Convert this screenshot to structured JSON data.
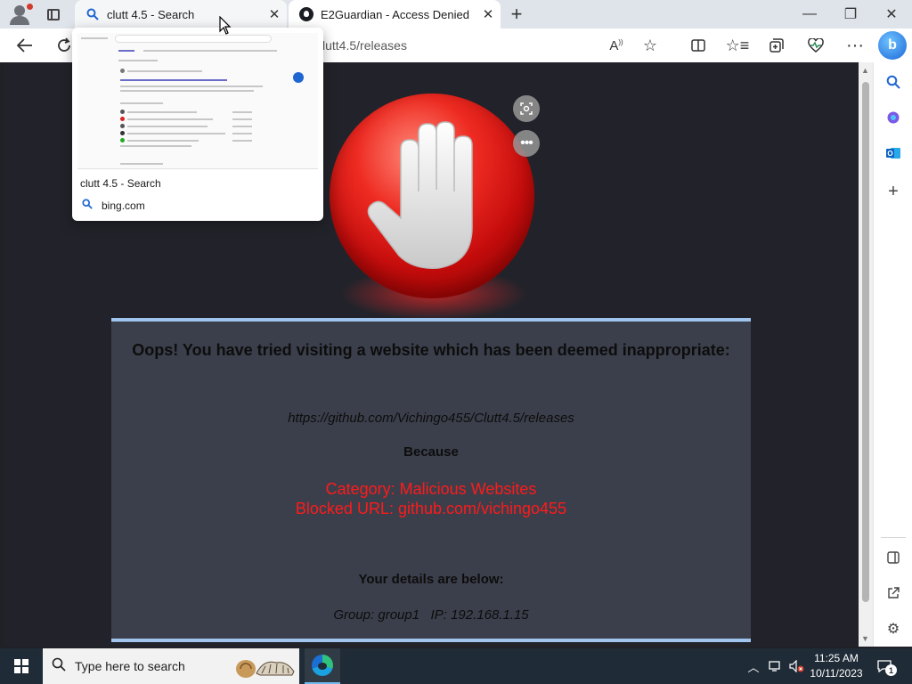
{
  "browser": {
    "tabs": [
      {
        "title": "clutt 4.5 - Search",
        "close": "✕"
      },
      {
        "title": "E2Guardian - Access Denied",
        "close": "✕"
      }
    ],
    "new_tab": "+",
    "window_controls": {
      "minimize": "—",
      "maximize": "❐",
      "close": "✕"
    },
    "address": "lutt4.5/releases",
    "toolbar_icons": [
      "back-icon",
      "refresh-icon",
      "read-aloud-icon",
      "favorite-star-icon",
      "split-screen-icon",
      "favorites-icon",
      "collections-icon",
      "performance-icon",
      "more-icon",
      "bing-copilot-icon"
    ],
    "sidebar_icons": [
      "search-icon",
      "copilot-icon",
      "outlook-icon",
      "add-icon",
      "sidebar-toggle-icon",
      "external-link-icon",
      "settings-icon"
    ]
  },
  "tab_preview": {
    "title": "clutt 4.5 - Search",
    "site": "bing.com"
  },
  "blocked_page": {
    "headline": "Oops! You have tried visiting a website which has been deemed inappropriate:",
    "url": "https://github.com/Vichingo455/Clutt4.5/releases",
    "because": "Because",
    "category": "Category: Malicious Websites",
    "blocked_url": "Blocked URL: github.com/vichingo455",
    "details_heading": "Your details are below:",
    "details": "Group: group1   IP: 192.168.1.15",
    "colors": {
      "reason": "#ff1a1a",
      "panel": "#3b3f4b",
      "panel_border": "#9fc4ee",
      "stop_sign": "#e02020"
    }
  },
  "taskbar": {
    "search_placeholder": "Type here to search",
    "time": "11:25 AM",
    "date": "10/11/2023",
    "notification_count": "1"
  }
}
